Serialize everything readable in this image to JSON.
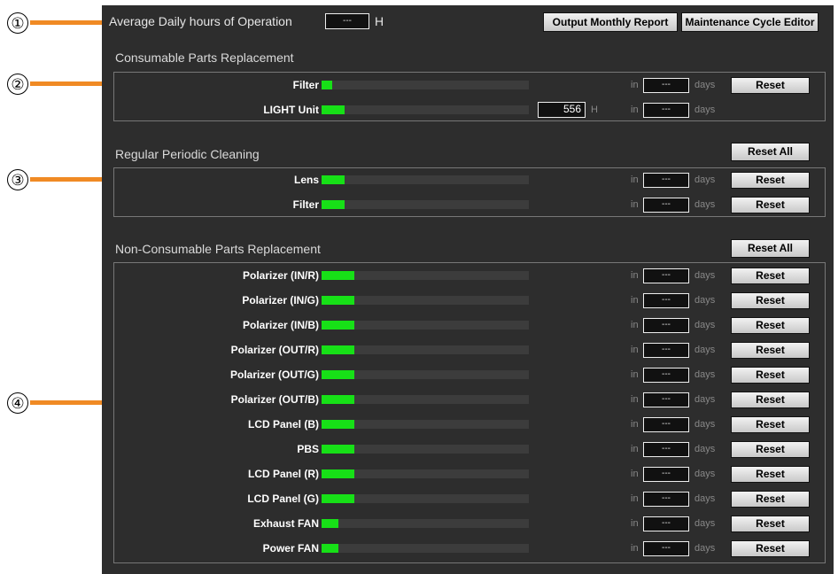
{
  "callouts": [
    "①",
    "②",
    "③",
    "④"
  ],
  "header": {
    "avg_label": "Average Daily hours of Operation",
    "avg_value": "---",
    "avg_unit": "H",
    "output_report_button": "Output Monthly Report",
    "cycle_editor_button": "Maintenance Cycle Editor"
  },
  "common": {
    "in_label": "in",
    "days_value": "---",
    "days_label": "days",
    "reset_label": "Reset",
    "reset_all_label": "Reset All"
  },
  "consumable": {
    "title": "Consumable Parts Replacement",
    "rows": [
      {
        "label": "Filter",
        "level": 0.05,
        "has_reset": true
      },
      {
        "label": "LIGHT Unit",
        "level": 0.11,
        "hours": "556",
        "hours_unit": "H",
        "has_reset": false
      }
    ]
  },
  "cleaning": {
    "title": "Regular Periodic Cleaning",
    "rows": [
      {
        "label": "Lens",
        "level": 0.11
      },
      {
        "label": "Filter",
        "level": 0.11
      }
    ]
  },
  "nonconsumable": {
    "title": "Non-Consumable Parts Replacement",
    "rows": [
      {
        "label": "Polarizer (IN/R)",
        "level": 0.16
      },
      {
        "label": "Polarizer (IN/G)",
        "level": 0.16
      },
      {
        "label": "Polarizer (IN/B)",
        "level": 0.16
      },
      {
        "label": "Polarizer (OUT/R)",
        "level": 0.16
      },
      {
        "label": "Polarizer (OUT/G)",
        "level": 0.16
      },
      {
        "label": "Polarizer (OUT/B)",
        "level": 0.16
      },
      {
        "label": "LCD Panel (B)",
        "level": 0.16
      },
      {
        "label": "PBS",
        "level": 0.16
      },
      {
        "label": "LCD Panel (R)",
        "level": 0.16
      },
      {
        "label": "LCD Panel (G)",
        "level": 0.16
      },
      {
        "label": "Exhaust FAN",
        "level": 0.08
      },
      {
        "label": "Power FAN",
        "level": 0.08
      }
    ]
  },
  "colors": {
    "panel_bg": "#2d2d2d",
    "bar_fill": "#17e017",
    "callout_line": "#f08a24"
  }
}
